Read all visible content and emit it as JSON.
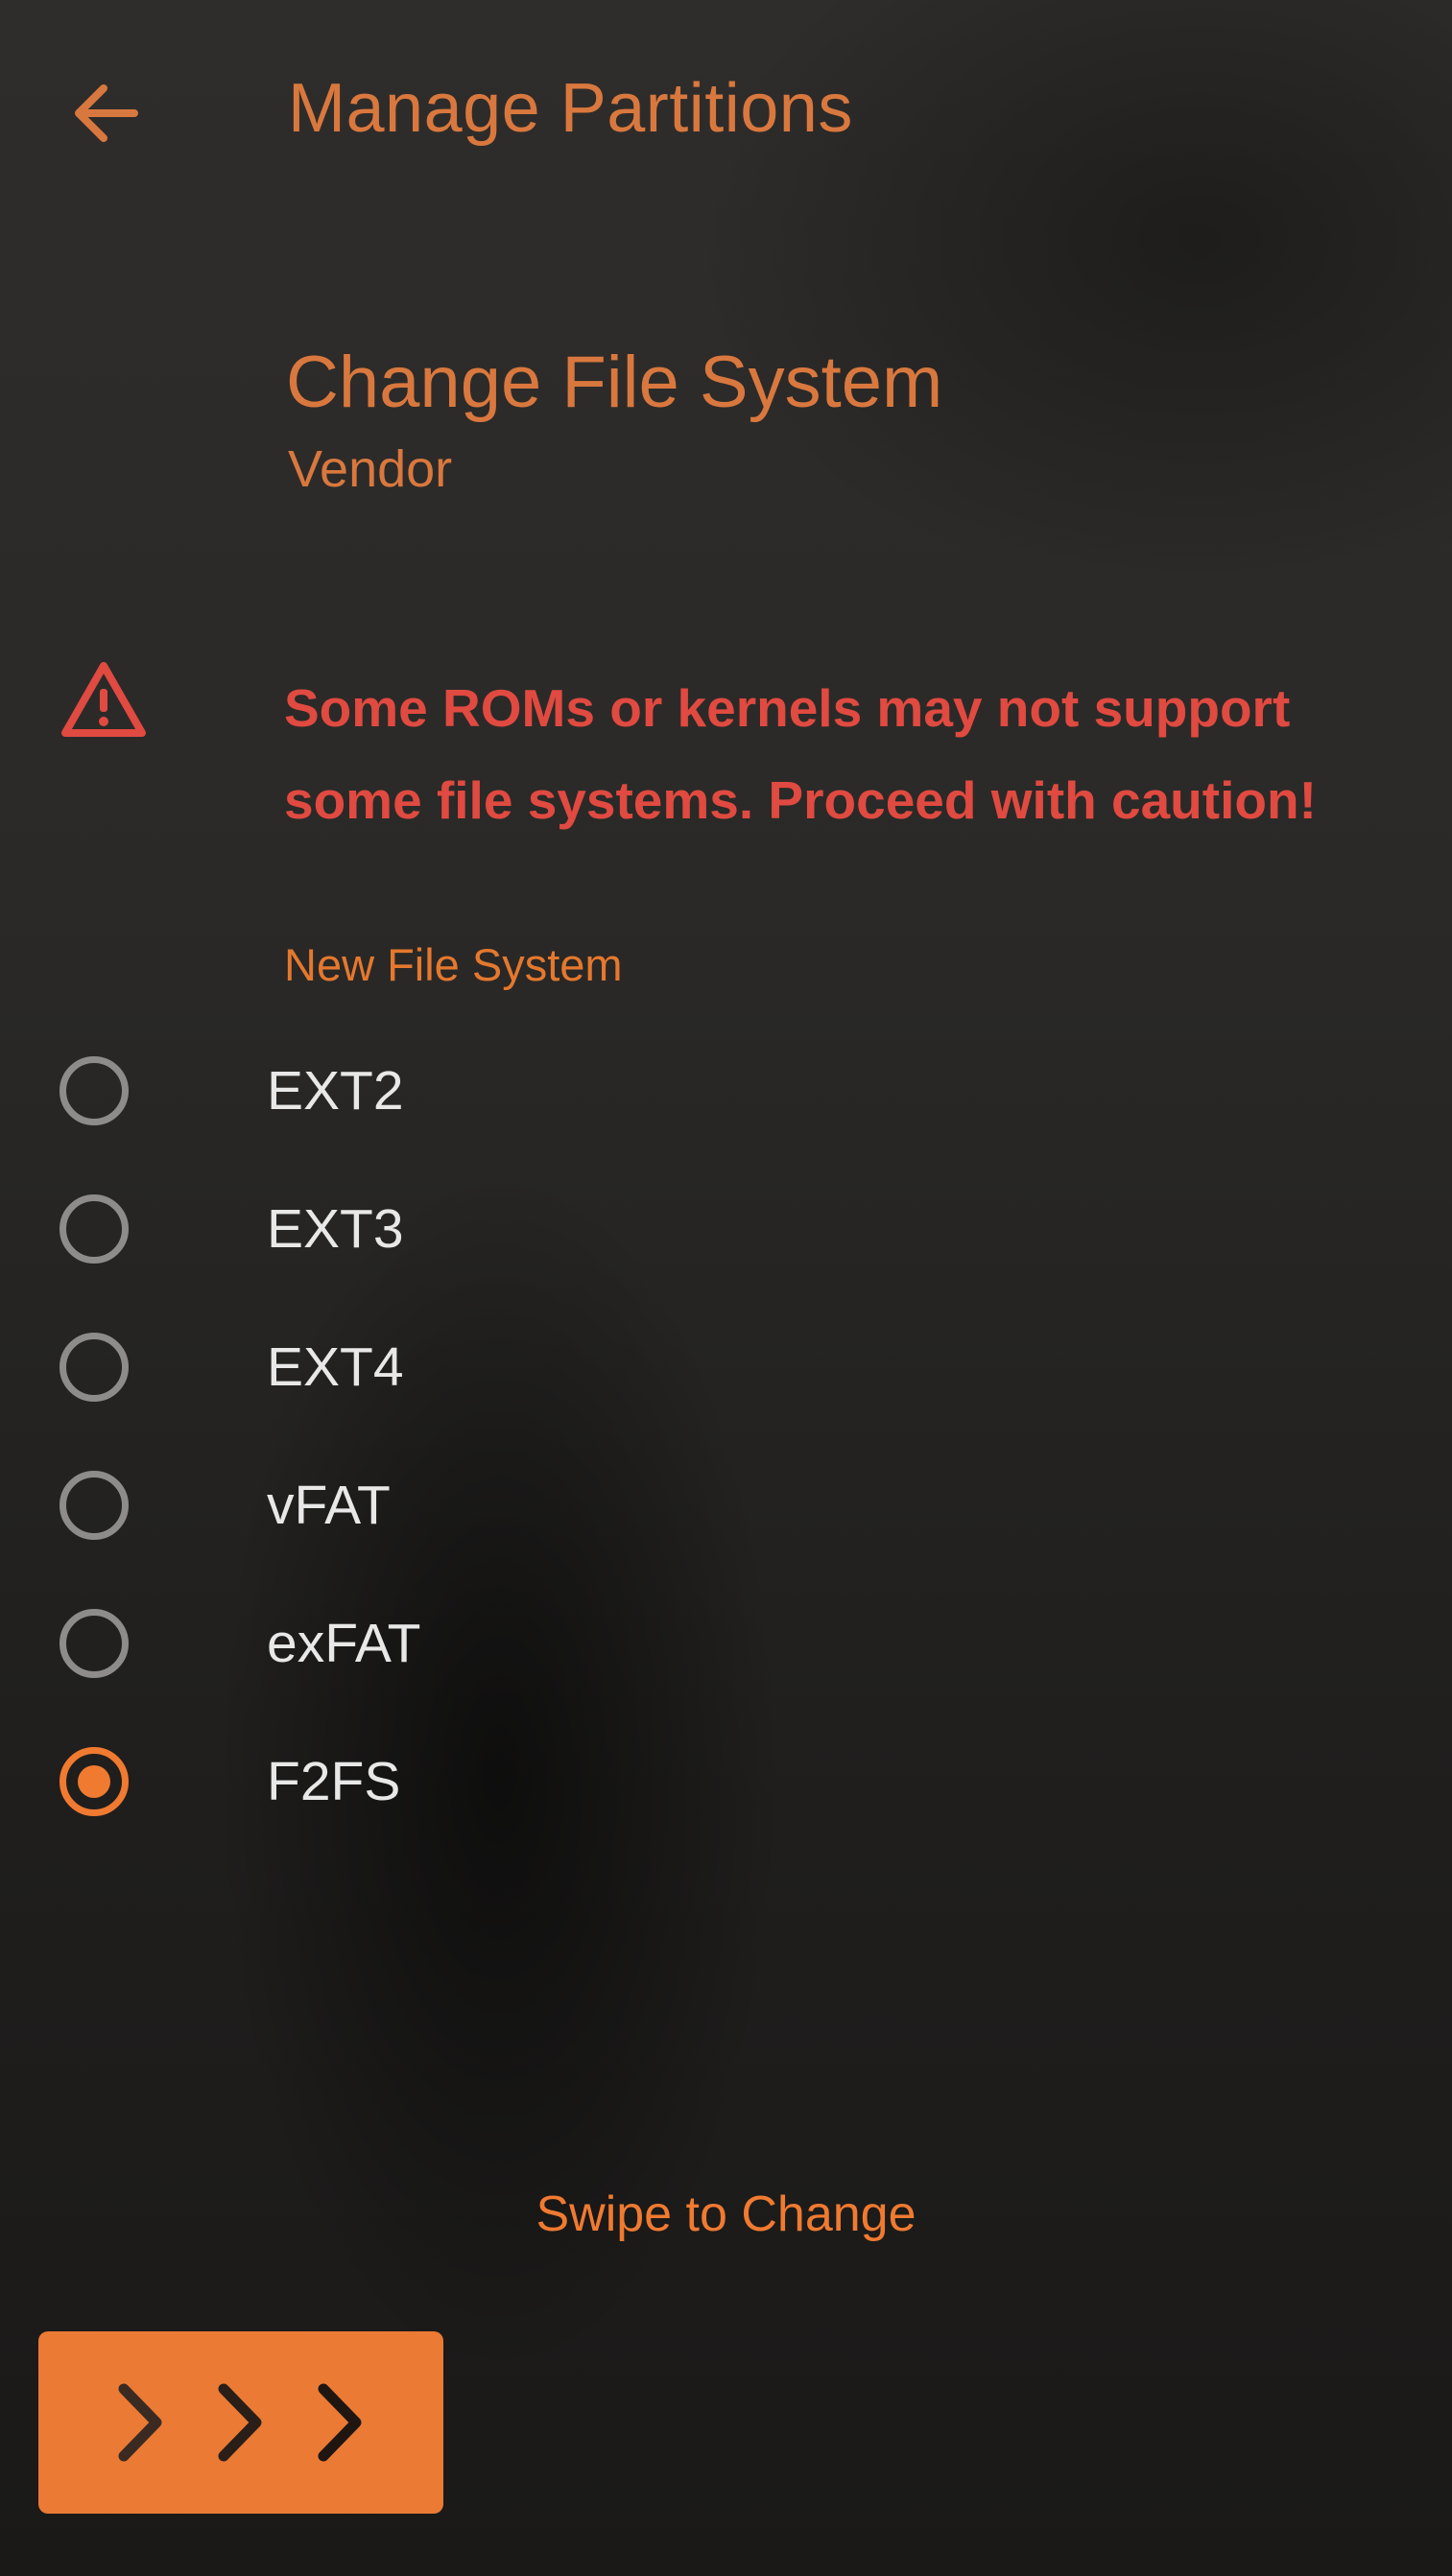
{
  "header": {
    "title": "Manage Partitions",
    "back_icon": "arrow-left-icon"
  },
  "section": {
    "title": "Change File System",
    "subtitle": "Vendor"
  },
  "warning": {
    "icon": "warning-triangle-icon",
    "lines": [
      "Some ROMs or kernels may not support",
      "some file systems. Proceed with caution!"
    ]
  },
  "file_system": {
    "label": "New File System",
    "options": [
      {
        "label": "EXT2",
        "selected": false
      },
      {
        "label": "EXT3",
        "selected": false
      },
      {
        "label": "EXT4",
        "selected": false
      },
      {
        "label": "vFAT",
        "selected": false
      },
      {
        "label": "exFAT",
        "selected": false
      },
      {
        "label": "F2FS",
        "selected": true
      }
    ]
  },
  "swipe": {
    "hint": "Swipe to Change",
    "handle_icon": "triple-chevron-right-icon"
  },
  "colors": {
    "accent": "#f07a30",
    "title": "#d9783e",
    "warning": "#e04a40",
    "option_text": "#e8e8e8",
    "radio_unchecked": "#8d8c8a"
  }
}
